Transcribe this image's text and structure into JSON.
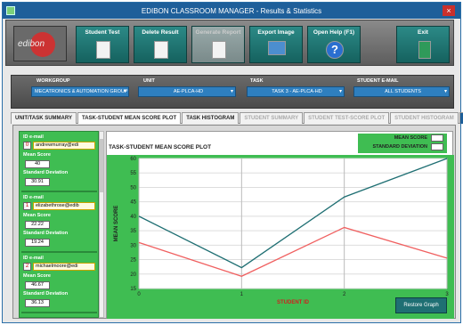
{
  "window": {
    "title": "EDIBON CLASSROOM MANAGER - Results & Statistics",
    "close_label": "×"
  },
  "logo": {
    "text": "edibon"
  },
  "toolbar": {
    "buttons": [
      {
        "label": "Student Test",
        "icon": "document-icon"
      },
      {
        "label": "Delete Result",
        "icon": "trash-document-icon"
      },
      {
        "label": "Generate Report",
        "icon": "report-icon"
      },
      {
        "label": "Export Image",
        "icon": "image-icon"
      },
      {
        "label": "Open Help (F1)",
        "icon": "help-icon",
        "glyph": "?"
      },
      {
        "label": "Exit",
        "icon": "exit-door-icon"
      }
    ]
  },
  "filters": {
    "workgroup": {
      "label": "WORKGROUP",
      "value": "MECATRONICS & AUTOMATION GROUP"
    },
    "unit": {
      "label": "UNIT",
      "value": "AE-PLCA-HD"
    },
    "task": {
      "label": "TASK",
      "value": "TASK 3 - AE-PLCA-HD"
    },
    "student_email": {
      "label": "STUDENT E-MAIL",
      "value": "ALL STUDENTS"
    }
  },
  "tabs": [
    {
      "label": "UNIT/TASK SUMMARY",
      "state": "normal"
    },
    {
      "label": "TASK-STUDENT MEAN SCORE PLOT",
      "state": "active"
    },
    {
      "label": "TASK HISTOGRAM",
      "state": "normal"
    },
    {
      "label": "STUDENT SUMMARY",
      "state": "dim"
    },
    {
      "label": "STUDENT TEST-SCORE PLOT",
      "state": "dim"
    },
    {
      "label": "STUDENT HISTOGRAM",
      "state": "dim"
    }
  ],
  "students": [
    {
      "id": "0",
      "email": "andrewmurray@edi",
      "mean_score": "40",
      "std_dev": "30.91"
    },
    {
      "id": "1",
      "email": "elizabethrose@edib",
      "mean_score": "22.22",
      "std_dev": "19.24"
    },
    {
      "id": "2",
      "email": "michaelmoore@edi",
      "mean_score": "46.67",
      "std_dev": "36.13"
    }
  ],
  "labels": {
    "id_email": "ID   e-mail",
    "mean_score": "Mean Score",
    "std_dev": "Standard Deviation",
    "restore": "Restore Graph"
  },
  "chart_data": {
    "type": "line",
    "title": "TASK-STUDENT MEAN SCORE PLOT",
    "xlabel": "STUDENT ID",
    "ylabel": "MEAN SCORE",
    "x": [
      0,
      1,
      2,
      3
    ],
    "xlim": [
      0,
      3
    ],
    "ylim": [
      15,
      60
    ],
    "yticks": [
      15,
      20,
      25,
      30,
      35,
      40,
      45,
      50,
      55,
      60
    ],
    "xticks": [
      0,
      1,
      2,
      3
    ],
    "grid": true,
    "legend_position": "top-right",
    "series": [
      {
        "name": "MEAN SCORE",
        "color": "#1f6f73",
        "values": [
          40,
          22.22,
          46.67,
          60
        ]
      },
      {
        "name": "STANDARD DEVIATION",
        "color": "#f06060",
        "values": [
          30.91,
          19.24,
          36.13,
          25.5
        ]
      }
    ]
  }
}
